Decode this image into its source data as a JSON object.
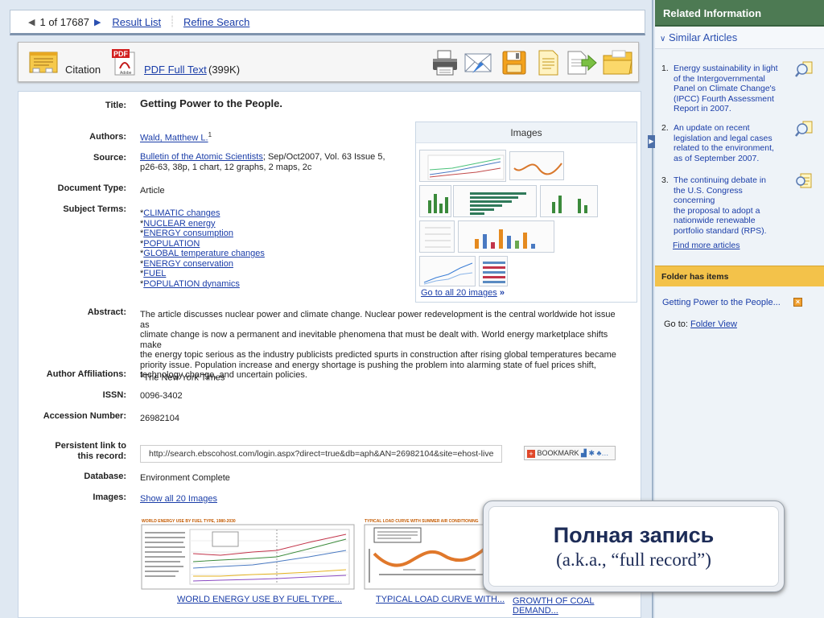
{
  "navbar": {
    "position_current": "1",
    "position_of": "of 17687",
    "result_list": "Result List",
    "refine_search": "Refine Search"
  },
  "toolbar": {
    "citation_label": "Citation",
    "pdf_label": "PDF Full Text",
    "pdf_size": "(399K)",
    "pdf_badge": "PDF",
    "adobe_badge": "Adobe"
  },
  "record": {
    "title_label": "Title:",
    "title": "Getting Power to the People.",
    "authors_label": "Authors:",
    "author_name": "Wald, Matthew L.",
    "author_sup": "1",
    "source_label": "Source:",
    "source_journal": "Bulletin of the Atomic Scientists",
    "source_rest_1": "; Sep/Oct2007, Vol. 63 Issue 5,",
    "source_rest_2": "p26-63, 38p, 1 chart, 12 graphs, 2 maps, 2c",
    "doctype_label": "Document Type:",
    "doctype": "Article",
    "subject_label": "Subject Terms:",
    "subjects": [
      "CLIMATIC changes",
      "NUCLEAR energy",
      "ENERGY consumption",
      "POPULATION",
      "GLOBAL temperature changes",
      "ENERGY conservation",
      "FUEL",
      "POPULATION dynamics"
    ],
    "abstract_label": "Abstract:",
    "abstract_lines": [
      "The article discusses nuclear power and climate change. Nuclear power redevelopment is the central worldwide hot issue as",
      "climate change is now a permanent and inevitable phenomena that must be dealt with. World energy marketplace shifts make",
      "the energy topic serious as the industry publicists predicted spurts in construction after rising global temperatures became",
      "priority issue. Population increase and energy shortage is pushing the problem into alarming state of fuel prices shift,",
      "technology change, and uncertain policies."
    ],
    "affil_label": "Author Affiliations:",
    "affil_sup": "1",
    "affil": "The New York Times",
    "issn_label": "ISSN:",
    "issn": "0096-3402",
    "accession_label": "Accession Number:",
    "accession": "26982104",
    "persist_label_1": "Persistent link to",
    "persist_label_2": "this record:",
    "persist_url": "http://search.ebscohost.com/login.aspx?direct=true&db=aph&AN=26982104&site=ehost-live",
    "bookmark": "BOOKMARK",
    "database_label": "Database:",
    "database": "Environment Complete",
    "images_label": "Images:",
    "show_all_images": "Show all 20 Images",
    "captions": [
      "WORLD ENERGY USE BY FUEL TYPE...",
      "TYPICAL LOAD CURVE WITH...",
      "GROWTH OF COAL DEMAND..."
    ],
    "thumb_titles": [
      "WORLD ENERGY USE BY FUEL TYPE, 1980-2030",
      "TYPICAL LOAD CURVE WITH SUMMER AIR CONDITIONING"
    ]
  },
  "images_panel": {
    "heading": "Images",
    "goto_all": "Go to all 20 images",
    "goto_arrow": "»"
  },
  "sidebar": {
    "related_heading": "Related Information",
    "similar_heading": "Similar Articles",
    "articles": [
      {
        "num": "1.",
        "lines": [
          "Energy sustainability in light",
          "of the Intergovernmental",
          "Panel on Climate Change's",
          "(IPCC) Fourth Assessment",
          "Report in 2007."
        ]
      },
      {
        "num": "2.",
        "lines": [
          "An update on recent",
          "legislation and legal cases",
          "related to the environment,",
          " as of September 2007."
        ]
      },
      {
        "num": "3.",
        "lines": [
          "The continuing debate in",
          "the U.S. Congress concerning",
          "the proposal to adopt a",
          "nationwide renewable",
          "portfolio standard (RPS)."
        ]
      }
    ],
    "find_more": "Find more articles",
    "folder_heading": "Folder has items",
    "folder_item": "Getting Power to the People...",
    "goto_label": "Go to:",
    "folder_view": "Folder View"
  },
  "overlay": {
    "title": "Полная запись",
    "subtitle": "(a.k.a., “full record”)"
  },
  "colors": {
    "accent_green": "#4d7a53",
    "folder_yellow": "#f3c24a",
    "link_blue": "#1a3da8"
  }
}
